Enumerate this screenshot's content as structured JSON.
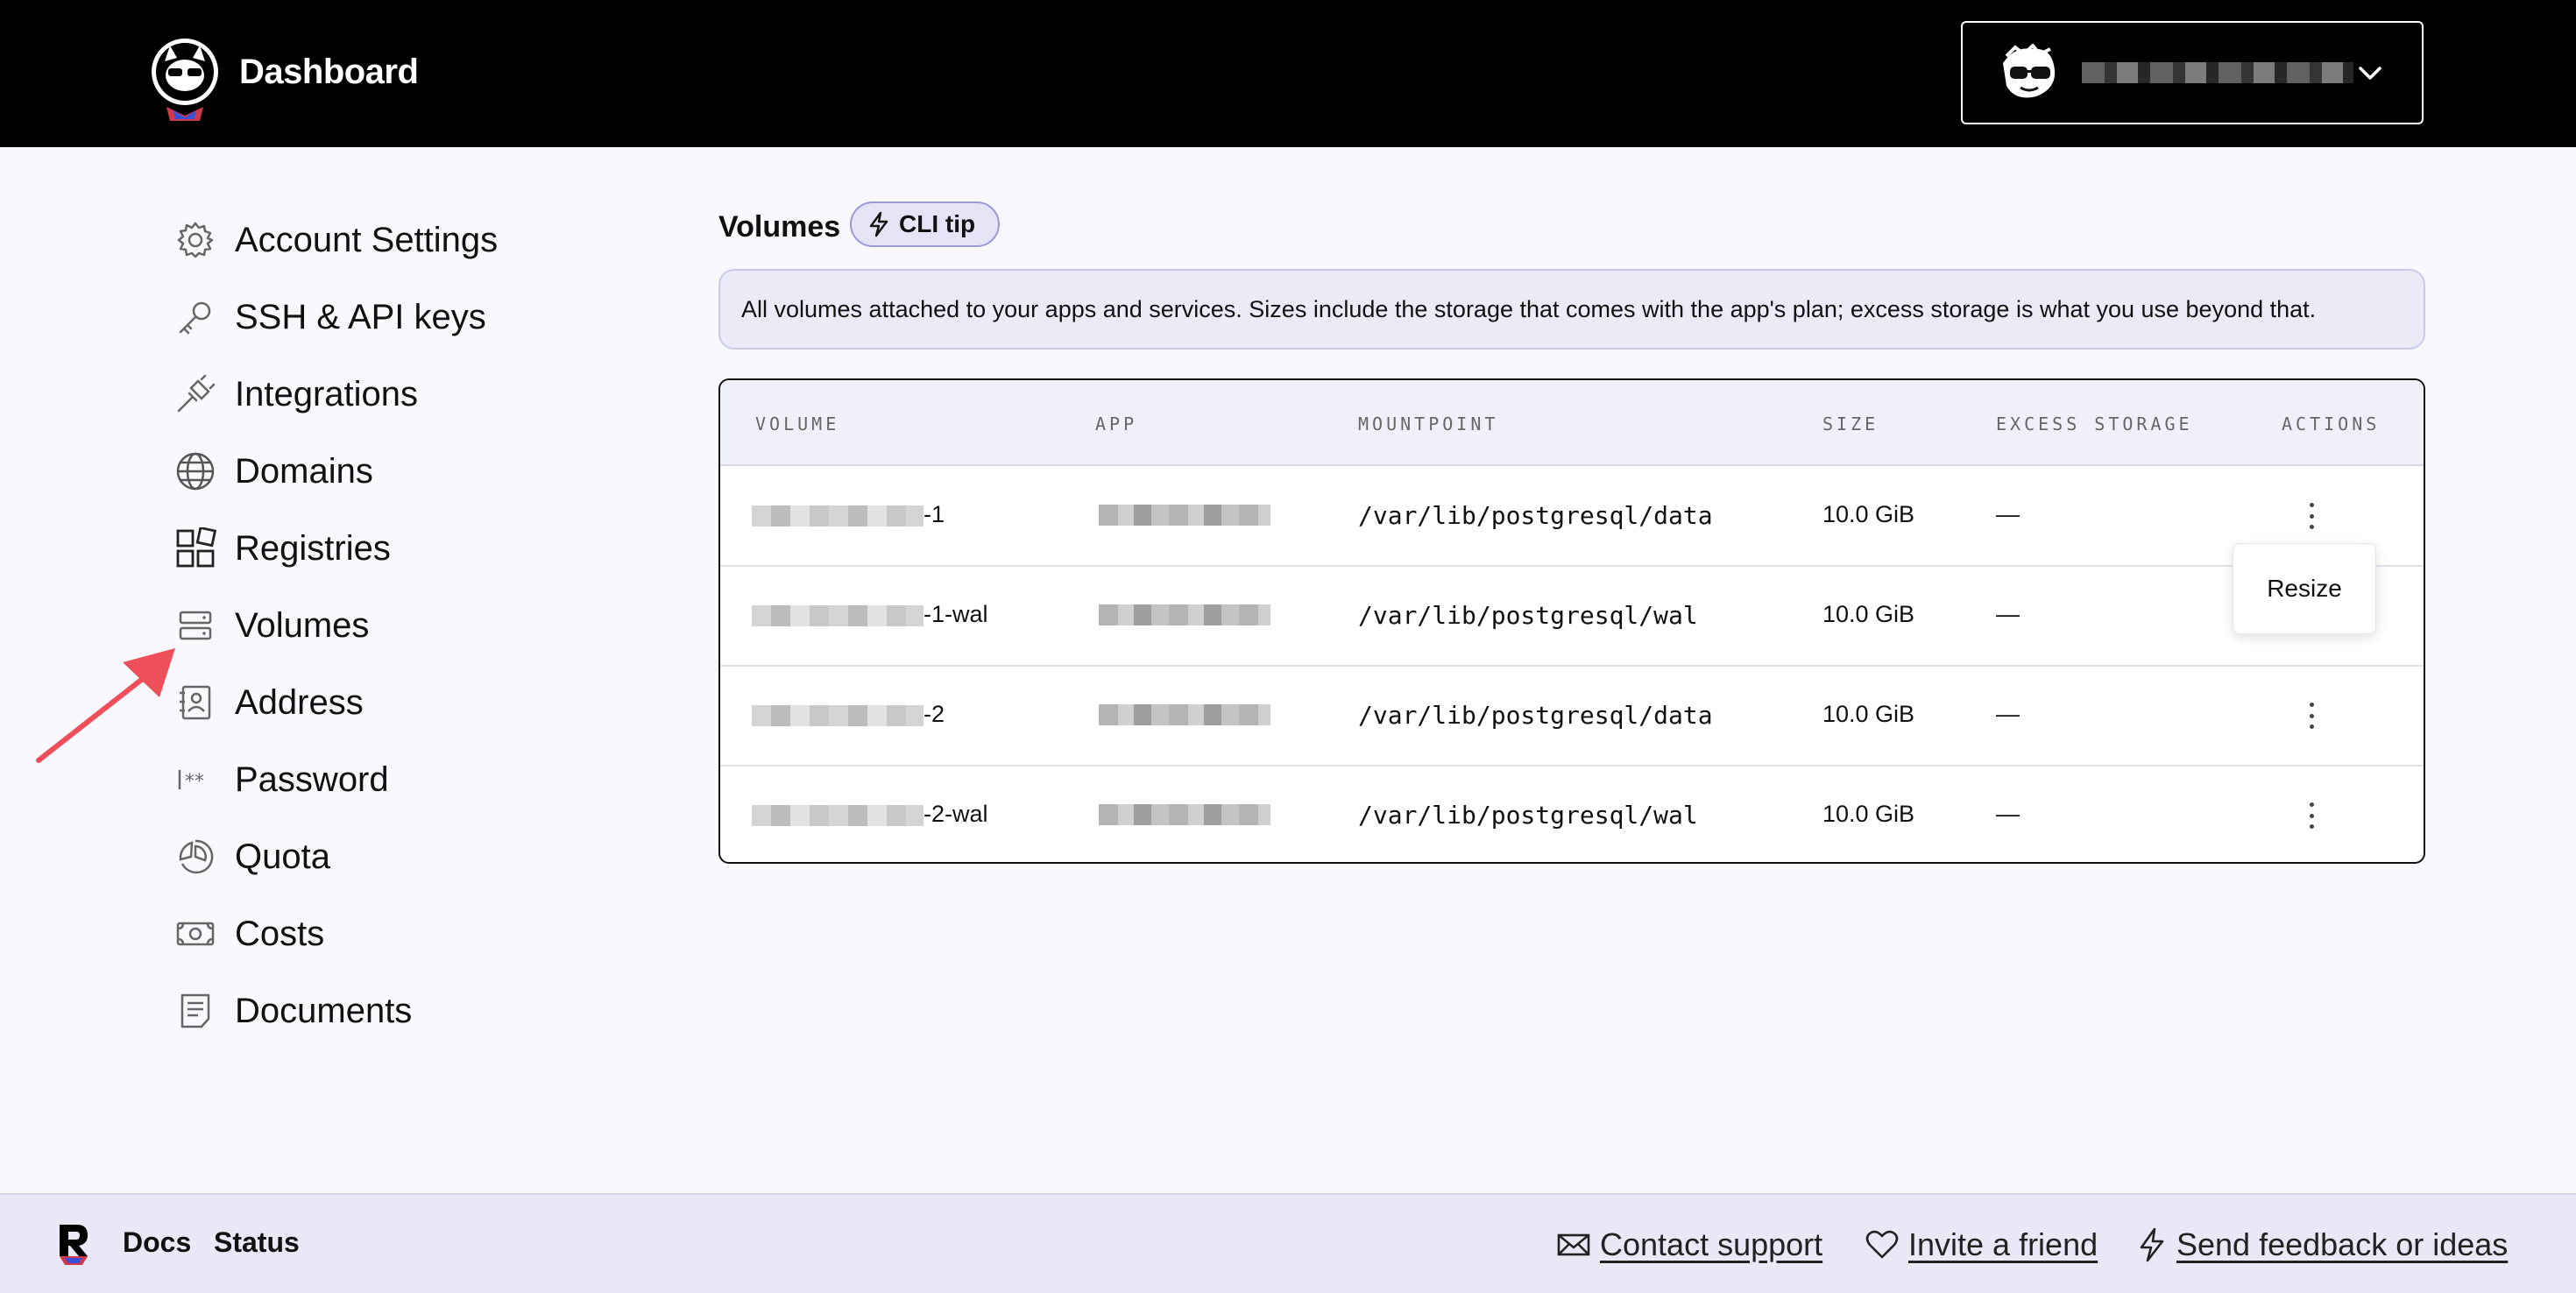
{
  "header": {
    "title": "Dashboard",
    "account_name": "",
    "icons": {
      "logo": "cat-mascot-logo",
      "avatar": "sunglasses-avatar-icon",
      "chevron": "chevron-down-icon"
    }
  },
  "sidebar": {
    "items": [
      {
        "label": "Account Settings",
        "icon": "gear-icon"
      },
      {
        "label": "SSH & API keys",
        "icon": "key-icon"
      },
      {
        "label": "Integrations",
        "icon": "plug-icon"
      },
      {
        "label": "Domains",
        "icon": "globe-icon"
      },
      {
        "label": "Registries",
        "icon": "grid-icon"
      },
      {
        "label": "Volumes",
        "icon": "server-icon"
      },
      {
        "label": "Address",
        "icon": "address-book-icon"
      },
      {
        "label": "Password",
        "icon": "password-icon"
      },
      {
        "label": "Quota",
        "icon": "pie-chart-icon"
      },
      {
        "label": "Costs",
        "icon": "money-icon"
      },
      {
        "label": "Documents",
        "icon": "document-icon"
      }
    ]
  },
  "main": {
    "title": "Volumes",
    "cli_tip_label": "CLI tip",
    "info_text": "All volumes attached to your apps and services. Sizes include the storage that comes with the app's plan; excess storage is what you use beyond that.",
    "table": {
      "columns": [
        "VOLUME",
        "APP",
        "MOUNTPOINT",
        "SIZE",
        "EXCESS STORAGE",
        "ACTIONS"
      ],
      "rows": [
        {
          "volume_suffix": "-1",
          "mountpoint": "/var/lib/postgresql/data",
          "size": "10.0 GiB",
          "excess": "—"
        },
        {
          "volume_suffix": "-1-wal",
          "mountpoint": "/var/lib/postgresql/wal",
          "size": "10.0 GiB",
          "excess": "—"
        },
        {
          "volume_suffix": "-2",
          "mountpoint": "/var/lib/postgresql/data",
          "size": "10.0 GiB",
          "excess": "—"
        },
        {
          "volume_suffix": "-2-wal",
          "mountpoint": "/var/lib/postgresql/wal",
          "size": "10.0 GiB",
          "excess": "—"
        }
      ]
    },
    "actions_menu": {
      "items": [
        "Resize"
      ]
    }
  },
  "footer": {
    "docs": "Docs",
    "status": "Status",
    "contact_support": "Contact support",
    "invite_friend": "Invite a friend",
    "send_feedback": "Send feedback or ideas"
  },
  "colors": {
    "header_bg": "#000000",
    "page_bg": "#f8f8fd",
    "accent_purple": "#9a9ad6",
    "arrow_red": "#ef4f5a"
  }
}
